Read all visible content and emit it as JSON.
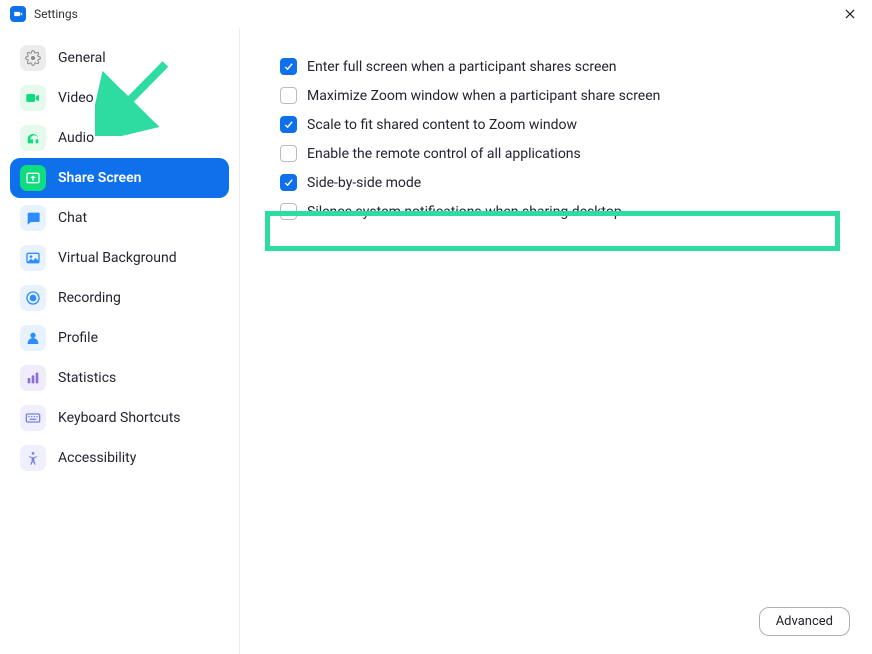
{
  "titlebar": {
    "title": "Settings"
  },
  "sidebar": {
    "items": [
      {
        "label": "General",
        "icon": "general",
        "bg": "#ececec",
        "fg": "#8a8a8a",
        "active": false
      },
      {
        "label": "Video",
        "icon": "video",
        "bg": "#e6f9ed",
        "fg": "#0edc7f",
        "active": false
      },
      {
        "label": "Audio",
        "icon": "audio",
        "bg": "#e6f9ed",
        "fg": "#0edc7f",
        "active": false
      },
      {
        "label": "Share Screen",
        "icon": "share",
        "bg": "#0edc7f",
        "fg": "#ffffff",
        "active": true
      },
      {
        "label": "Chat",
        "icon": "chat",
        "bg": "#e7f2fd",
        "fg": "#2d8cff",
        "active": false
      },
      {
        "label": "Virtual Background",
        "icon": "vbg",
        "bg": "#e7f2fd",
        "fg": "#2d8cff",
        "active": false
      },
      {
        "label": "Recording",
        "icon": "record",
        "bg": "#e7f2fd",
        "fg": "#2d8cff",
        "active": false
      },
      {
        "label": "Profile",
        "icon": "profile",
        "bg": "#e7f2fd",
        "fg": "#2d8cff",
        "active": false
      },
      {
        "label": "Statistics",
        "icon": "stats",
        "bg": "#f0ecfb",
        "fg": "#8e6cd9",
        "active": false
      },
      {
        "label": "Keyboard Shortcuts",
        "icon": "keyboard",
        "bg": "#efeffd",
        "fg": "#7782e0",
        "active": false
      },
      {
        "label": "Accessibility",
        "icon": "accessibility",
        "bg": "#efeffd",
        "fg": "#7782e0",
        "active": false
      }
    ]
  },
  "options": [
    {
      "label": "Enter full screen when a participant shares screen",
      "checked": true
    },
    {
      "label": "Maximize Zoom window when a participant share screen",
      "checked": false
    },
    {
      "label": "Scale to fit shared content to Zoom window",
      "checked": true
    },
    {
      "label": "Enable the remote control of all applications",
      "checked": false
    },
    {
      "label": "Side-by-side mode",
      "checked": true
    },
    {
      "label": "Silence system notifications when sharing desktop",
      "checked": false
    }
  ],
  "buttons": {
    "advanced": "Advanced"
  }
}
